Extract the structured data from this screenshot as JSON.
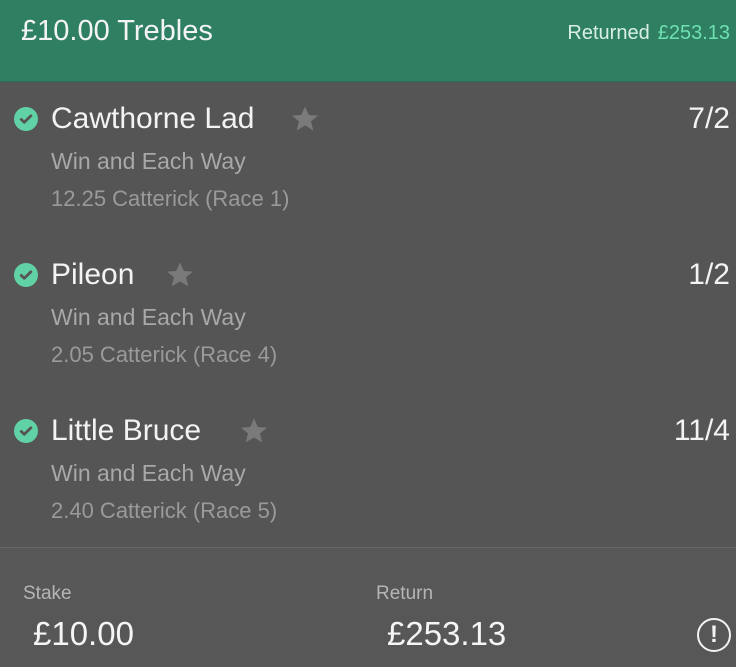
{
  "header": {
    "title": "£10.00 Trebles",
    "returned_label": "Returned",
    "returned_amount": "£253.13",
    "bg_color": "#2f7f63",
    "accent_color": "#6fe0b0"
  },
  "selections": [
    {
      "name": "Cawthorne Lad",
      "odds": "7/2",
      "bet_type": "Win and Each Way",
      "race": "12.25 Catterick (Race 1)",
      "status_icon": "check-circle-icon",
      "favorite_icon": "star-icon"
    },
    {
      "name": "Pileon",
      "odds": "1/2",
      "bet_type": "Win and Each Way",
      "race": "2.05 Catterick (Race 4)",
      "status_icon": "check-circle-icon",
      "favorite_icon": "star-icon"
    },
    {
      "name": "Little Bruce",
      "odds": "11/4",
      "bet_type": "Win and Each Way",
      "race": "2.40 Catterick (Race 5)",
      "status_icon": "check-circle-icon",
      "favorite_icon": "star-icon"
    }
  ],
  "footer": {
    "stake_label": "Stake",
    "stake_value": "£10.00",
    "return_label": "Return",
    "return_value": "£253.13",
    "alert_icon": "exclamation-circle-icon"
  },
  "colors": {
    "background": "#555555",
    "check": "#61d2a6",
    "secondary_text": "#a8a8a8"
  }
}
